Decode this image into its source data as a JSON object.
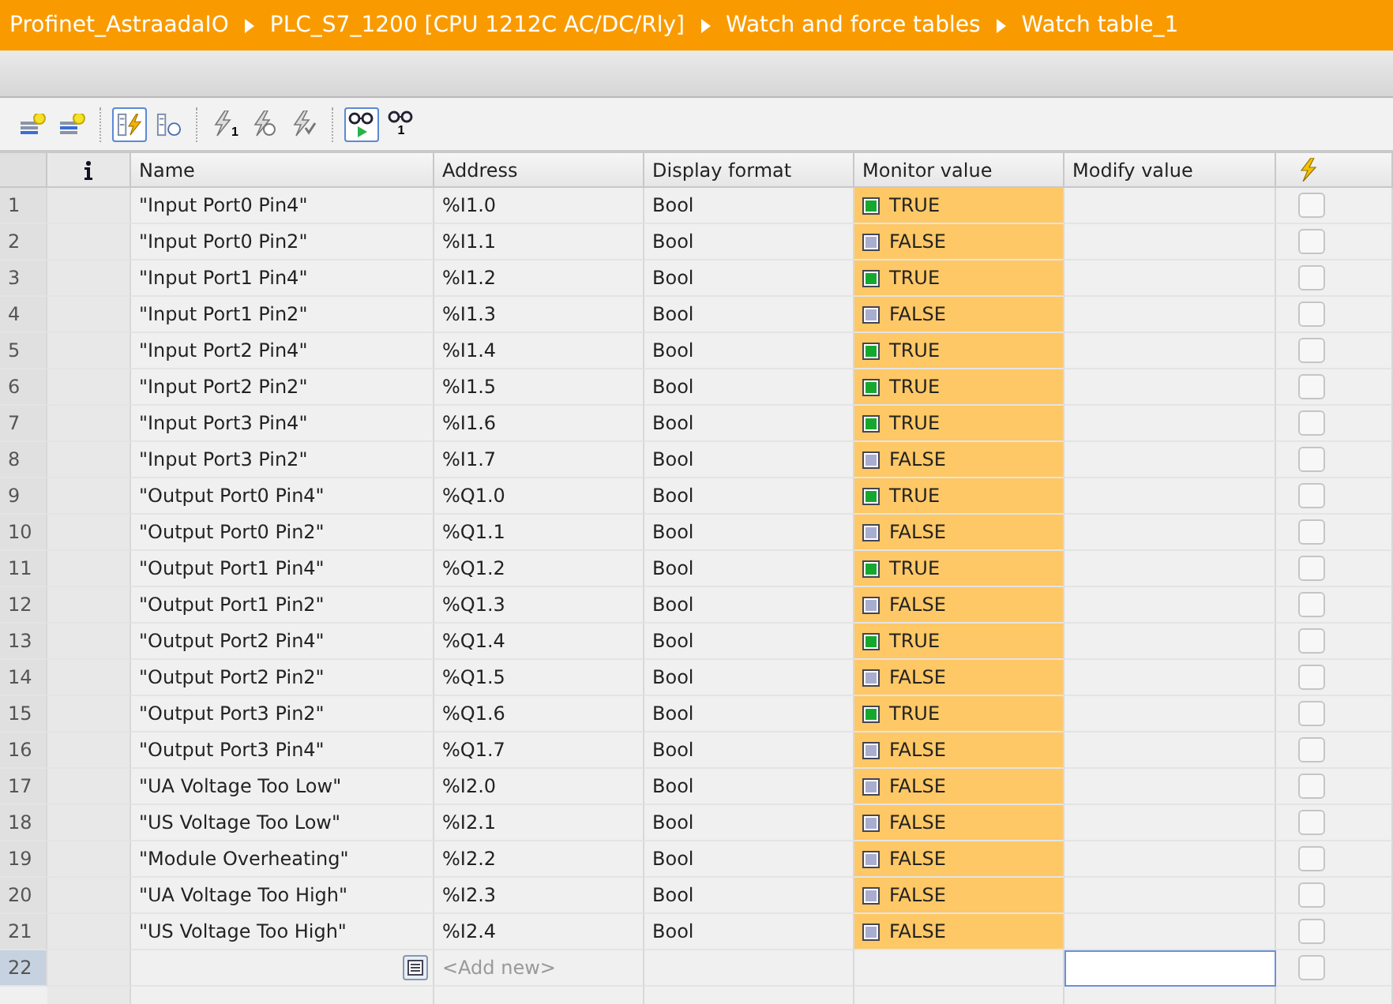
{
  "breadcrumb": [
    "Profinet_AstraadaIO",
    "PLC_S7_1200 [CPU 1212C AC/DC/Rly]",
    "Watch and force tables",
    "Watch table_1"
  ],
  "toolbar": [
    {
      "kind": "insert-row",
      "selected": false
    },
    {
      "kind": "add-row",
      "selected": false
    },
    {
      "sep": true,
      "kind": "modify-now",
      "selected": true
    },
    {
      "kind": "modify-trigger",
      "selected": false
    },
    {
      "sep": true,
      "kind": "force",
      "badge": "1",
      "selected": false
    },
    {
      "kind": "force-trigger",
      "selected": false
    },
    {
      "kind": "force-all",
      "selected": false
    },
    {
      "sep": true,
      "kind": "monitor-all",
      "selected": true
    },
    {
      "kind": "monitor-once",
      "badge": "1",
      "selected": false
    }
  ],
  "columns": [
    "Name",
    "Address",
    "Display format",
    "Monitor value",
    "Modify value"
  ],
  "rows": [
    {
      "n": "1",
      "name": "\"Input Port0 Pin4\"",
      "address": "%I1.0",
      "format": "Bool",
      "monitor": "TRUE",
      "on": true,
      "force": false
    },
    {
      "n": "2",
      "name": "\"Input Port0 Pin2\"",
      "address": "%I1.1",
      "format": "Bool",
      "monitor": "FALSE",
      "on": false,
      "force": false
    },
    {
      "n": "3",
      "name": "\"Input Port1 Pin4\"",
      "address": "%I1.2",
      "format": "Bool",
      "monitor": "TRUE",
      "on": true,
      "force": false
    },
    {
      "n": "4",
      "name": "\"Input Port1 Pin2\"",
      "address": "%I1.3",
      "format": "Bool",
      "monitor": "FALSE",
      "on": false,
      "force": false
    },
    {
      "n": "5",
      "name": "\"Input Port2 Pin4\"",
      "address": "%I1.4",
      "format": "Bool",
      "monitor": "TRUE",
      "on": true,
      "force": false
    },
    {
      "n": "6",
      "name": "\"Input Port2 Pin2\"",
      "address": "%I1.5",
      "format": "Bool",
      "monitor": "TRUE",
      "on": true,
      "force": false
    },
    {
      "n": "7",
      "name": "\"Input Port3 Pin4\"",
      "address": "%I1.6",
      "format": "Bool",
      "monitor": "TRUE",
      "on": true,
      "force": false
    },
    {
      "n": "8",
      "name": "\"Input Port3 Pin2\"",
      "address": "%I1.7",
      "format": "Bool",
      "monitor": "FALSE",
      "on": false,
      "force": false
    },
    {
      "n": "9",
      "name": "\"Output Port0 Pin4\"",
      "address": "%Q1.0",
      "format": "Bool",
      "monitor": "TRUE",
      "on": true,
      "force": false
    },
    {
      "n": "10",
      "name": "\"Output Port0 Pin2\"",
      "address": "%Q1.1",
      "format": "Bool",
      "monitor": "FALSE",
      "on": false,
      "force": false
    },
    {
      "n": "11",
      "name": "\"Output Port1 Pin4\"",
      "address": "%Q1.2",
      "format": "Bool",
      "monitor": "TRUE",
      "on": true,
      "force": false
    },
    {
      "n": "12",
      "name": "\"Output Port1 Pin2\"",
      "address": "%Q1.3",
      "format": "Bool",
      "monitor": "FALSE",
      "on": false,
      "force": false
    },
    {
      "n": "13",
      "name": "\"Output Port2 Pin4\"",
      "address": "%Q1.4",
      "format": "Bool",
      "monitor": "TRUE",
      "on": true,
      "force": false
    },
    {
      "n": "14",
      "name": "\"Output Port2 Pin2\"",
      "address": "%Q1.5",
      "format": "Bool",
      "monitor": "FALSE",
      "on": false,
      "force": false
    },
    {
      "n": "15",
      "name": "\"Output Port3 Pin2\"",
      "address": "%Q1.6",
      "format": "Bool",
      "monitor": "TRUE",
      "on": true,
      "force": false
    },
    {
      "n": "16",
      "name": "\"Output Port3 Pin4\"",
      "address": "%Q1.7",
      "format": "Bool",
      "monitor": "FALSE",
      "on": false,
      "force": false
    },
    {
      "n": "17",
      "name": "\"UA Voltage Too Low\"",
      "address": "%I2.0",
      "format": "Bool",
      "monitor": "FALSE",
      "on": false,
      "force": false
    },
    {
      "n": "18",
      "name": "\"US Voltage Too Low\"",
      "address": "%I2.1",
      "format": "Bool",
      "monitor": "FALSE",
      "on": false,
      "force": false
    },
    {
      "n": "19",
      "name": "\"Module Overheating\"",
      "address": "%I2.2",
      "format": "Bool",
      "monitor": "FALSE",
      "on": false,
      "force": false
    },
    {
      "n": "20",
      "name": "\"UA Voltage Too High\"",
      "address": "%I2.3",
      "format": "Bool",
      "monitor": "FALSE",
      "on": false,
      "force": false
    },
    {
      "n": "21",
      "name": "\"US Voltage Too High\"",
      "address": "%I2.4",
      "format": "Bool",
      "monitor": "FALSE",
      "on": false,
      "force": false
    }
  ],
  "new_row": {
    "n": "22",
    "hint": "<Add new>",
    "force": false
  }
}
